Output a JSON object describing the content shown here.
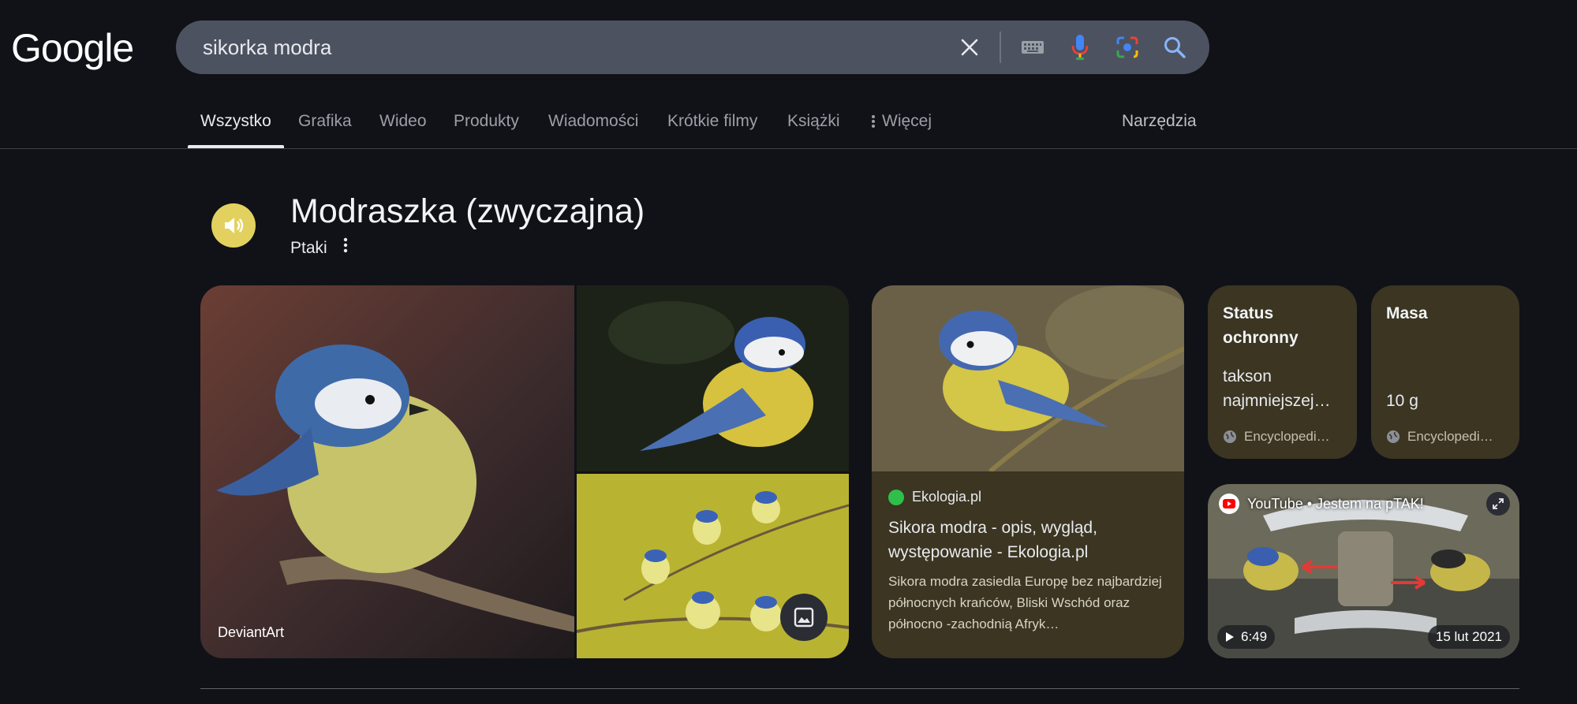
{
  "header": {
    "logo": "Google",
    "search": {
      "value": "sikorka modra"
    },
    "icons": [
      "clear-icon",
      "keyboard-icon",
      "microphone-icon",
      "lens-icon",
      "search-icon"
    ]
  },
  "tabs": [
    {
      "label": "Wszystko",
      "active": true
    },
    {
      "label": "Grafika"
    },
    {
      "label": "Wideo"
    },
    {
      "label": "Produkty"
    },
    {
      "label": "Wiadomości"
    },
    {
      "label": "Krótkie filmy"
    },
    {
      "label": "Książki"
    },
    {
      "label": "Więcej"
    }
  ],
  "tools_label": "Narzędzia",
  "entity": {
    "title": "Modraszka (zwyczajna)",
    "category": "Ptaki"
  },
  "gallery": {
    "main_source": "DeviantArt"
  },
  "article": {
    "source": "Ekologia.pl",
    "title": "Sikora modra - opis, wygląd, występowanie - Ekologia.pl",
    "snippet": "Sikora modra zasiedla Europę bez najbardziej północnych krańców, Bliski Wschód oraz północno -zachodnią Afryk…"
  },
  "facts": [
    {
      "title": "Status ochronny",
      "value": "takson najmniejszej…",
      "source": "Encyclopedi…"
    },
    {
      "title": "Masa",
      "value": "10 g",
      "source": "Encyclopedi…"
    }
  ],
  "video": {
    "source_line": "YouTube • Jestem na pTAK!",
    "duration": "6:49",
    "date": "15 lut 2021"
  },
  "colors": {
    "background": "#101218",
    "search_bar": "#4d5261",
    "card": "#3b3522",
    "speaker": "#e3d15f"
  }
}
